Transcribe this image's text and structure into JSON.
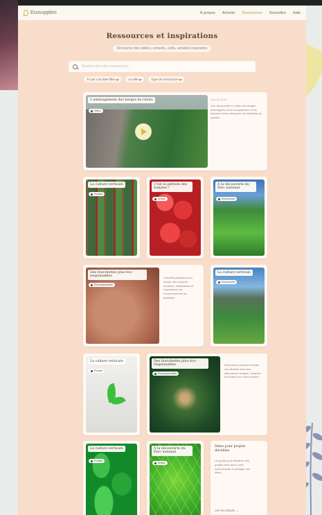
{
  "window": {
    "logo_text": "Ecosupplies",
    "nav": [
      "À propos",
      "Acheter",
      "Ressources",
      "Nouvelles",
      "Aide"
    ],
    "active_nav": "Ressources"
  },
  "hero": {
    "title": "Ressources et inspirations",
    "subtitle": "Découvrez des vidéos, conseils, outils, activités inspirantes"
  },
  "search": {
    "placeholder": "Rechercher des ressources..."
  },
  "filters": [
    {
      "label": "Tri par à la date filtre"
    },
    {
      "label": "La ville"
    },
    {
      "label": "Type de ressources"
    }
  ],
  "cards": [
    {
      "title": "L'aménagement des berges de Gloire",
      "tag": "Vidéo",
      "date": "Juin 23, 2023",
      "desc": "Une découverte en vidéo des berges aménagées, leurs écosystèmes et les espaces verts créés pour les habitants du quartier."
    },
    {
      "title": "La culture verticale",
      "tag": "Produit"
    },
    {
      "title": "C'est la période des tomates !",
      "tag": "Article"
    },
    {
      "title": "À la découverte du Parc national",
      "tag": "Découverte"
    },
    {
      "title": "Des fourchettes plus éco-responsables",
      "tag": "Écoresponsable",
      "desc": "Conseils pratiques pour choisir des couverts durables, réutilisables et respectueux de l'environnement au quotidien."
    },
    {
      "title": "La culture verticale",
      "tag": "Découverte"
    },
    {
      "title": "La culture verticale",
      "tag": "Produit"
    },
    {
      "title": "Des fourchettes plus éco-responsables",
      "tag": "Écoresponsable",
      "desc": "Découvrez comment réduire vos déchets avec des alternatives simples, durables et locales pour votre cuisine."
    },
    {
      "title": "La culture verticale",
      "tag": "Produit"
    },
    {
      "title": "À la découverte du Parc national",
      "tag": "Article"
    },
    {
      "title": "Idées pour projets durables",
      "desc": "Un guide pour démarrer des projets verts dans votre communauté et partager vos idées.",
      "link": "Voir les détails →"
    }
  ]
}
